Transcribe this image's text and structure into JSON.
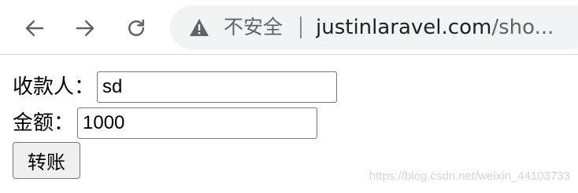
{
  "toolbar": {
    "back_icon": "arrow-left-icon",
    "forward_icon": "arrow-right-icon",
    "reload_icon": "reload-icon",
    "security_icon": "warning-triangle-icon",
    "security_label": "不安全",
    "url_host": "justinlaravel.com",
    "url_path": "/sho..."
  },
  "form": {
    "payee_label": "收款人：",
    "payee_value": "sd",
    "amount_label": "金额：",
    "amount_value": "1000",
    "submit_label": "转账"
  },
  "watermark": "https://blog.csdn.net/weixin_44103733",
  "colors": {
    "toolbar_icon": "#5f6368",
    "omnibox_bg": "#f1f3f4",
    "button_bg": "#efefef",
    "input_border": "#767676"
  }
}
